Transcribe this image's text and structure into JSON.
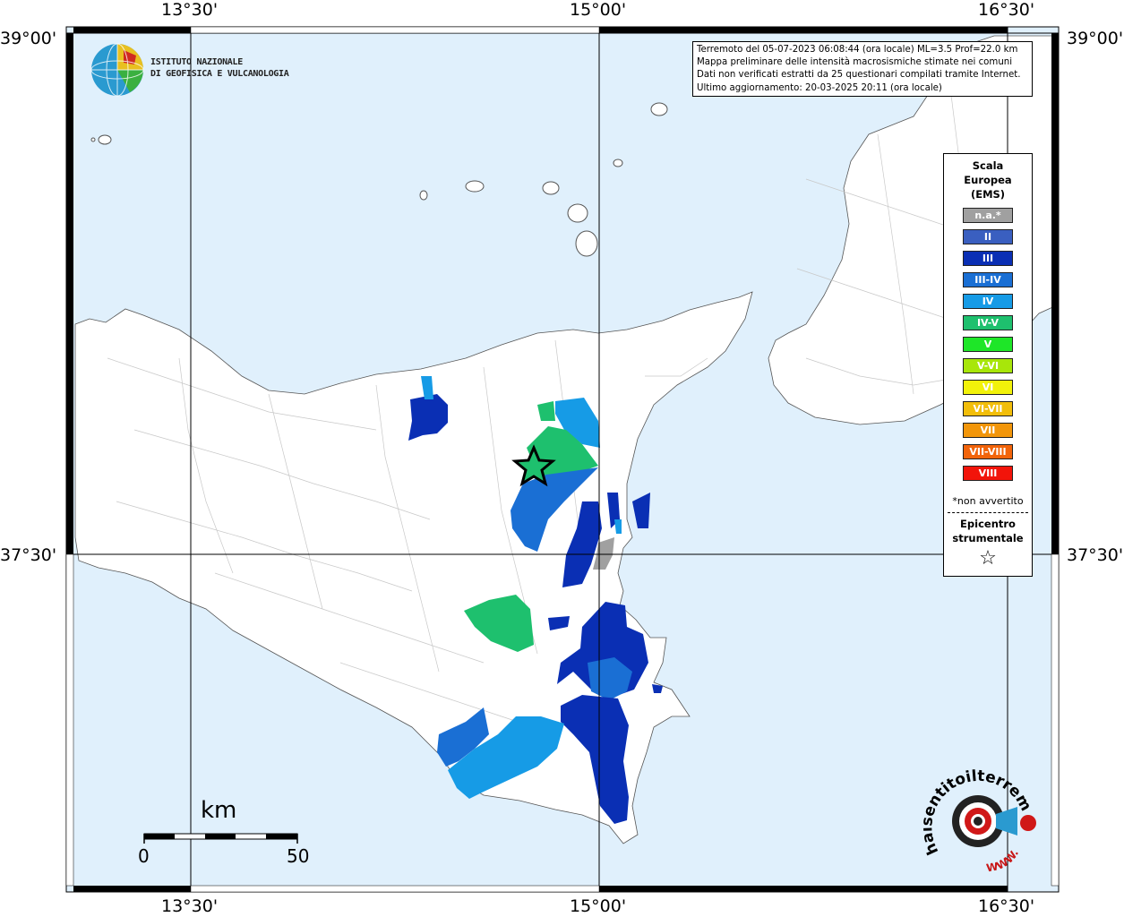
{
  "coords": {
    "top": [
      "13°30'",
      "15°00'",
      "16°30'"
    ],
    "bottom": [
      "13°30'",
      "15°00'",
      "16°30'"
    ],
    "left": [
      "39°00'",
      "37°30'"
    ],
    "right": [
      "39°00'",
      "37°30'"
    ]
  },
  "logo": {
    "line1": "ISTITUTO NAZIONALE",
    "line2": "DI GEOFISICA E VULCANOLOGIA"
  },
  "info": {
    "line1": "Terremoto del 05-07-2023 06:08:44 (ora locale) ML=3.5 Prof=22.0 km",
    "line2": "Mappa preliminare delle intensità macrosismiche stimate nei comuni",
    "line3": "Dati non verificati estratti da 25 questionari compilati tramite Internet.",
    "line4": "Ultimo aggiornamento: 20-03-2025 20:11 (ora locale)"
  },
  "legend": {
    "title1": "Scala",
    "title2": "Europea",
    "title3": "(EMS)",
    "items": [
      {
        "label": "n.a.*",
        "color": "#a0a0a0"
      },
      {
        "label": "II",
        "color": "#3a5fc0"
      },
      {
        "label": "III",
        "color": "#0a2fb4"
      },
      {
        "label": "III-IV",
        "color": "#1a6fd4"
      },
      {
        "label": "IV",
        "color": "#169be6"
      },
      {
        "label": "IV-V",
        "color": "#1ec06e"
      },
      {
        "label": "V",
        "color": "#1ee628"
      },
      {
        "label": "V-VI",
        "color": "#a8e60a"
      },
      {
        "label": "VI",
        "color": "#f2f20a"
      },
      {
        "label": "VI-VII",
        "color": "#f2be0a"
      },
      {
        "label": "VII",
        "color": "#f2960a"
      },
      {
        "label": "VII-VIII",
        "color": "#f2640a"
      },
      {
        "label": "VIII",
        "color": "#f2140a"
      }
    ],
    "note": "*non avvertito",
    "epi1": "Epicentro",
    "epi2": "strumentale",
    "star": "☆"
  },
  "scalebar": {
    "unit": "km",
    "start": "0",
    "end": "50"
  },
  "hse": {
    "text_arc": "haisentitoilterremoto.it",
    "www": "WWW."
  },
  "colors": {
    "sea": "#e0f0fc",
    "land": "#ffffff",
    "intensity_ii": "#3a5fc0",
    "intensity_iii": "#0a2fb4",
    "intensity_iii_iv": "#1a6fd4",
    "intensity_iv": "#169be6",
    "intensity_iv_v": "#1ec06e",
    "na": "#a0a0a0"
  }
}
